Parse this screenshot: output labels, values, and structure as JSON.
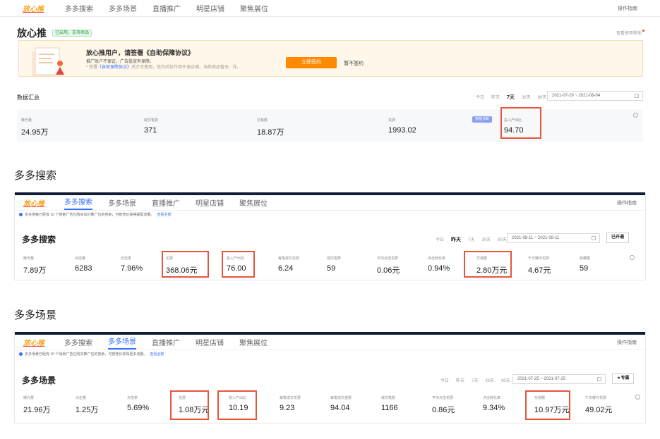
{
  "nav_items": [
    "多多搜索",
    "多多场景",
    "直播推广",
    "明星店铺",
    "聚焦展位"
  ],
  "logo_text": "放心推",
  "nav_right": "操作指南",
  "s1": {
    "title": "放心推",
    "badge": "已启用，支持商品",
    "help": "查看使用帮助",
    "banner": {
      "title": "放心推用户，请签署《自助保障协议》",
      "line1": "推广账户不保证，广告投放有保障。",
      "line2_pre": "* 签署",
      "line2_link": "《自助保障协议》",
      "line2_post": "后才可使用，签约后仅作用于该店铺，当前商品暂无 · 详。",
      "button": "立即签约",
      "after": "暂不签约"
    },
    "summary_title": "数据汇总",
    "quick_dates": [
      "今日",
      "昨天",
      "7天",
      "30天",
      "90天"
    ],
    "active_quick": "7天",
    "date_range": "2021-07-29 ~ 2021-08-04",
    "smart_button": "智能诊断",
    "metrics": [
      {
        "label": "曝光量",
        "value": "24.95万"
      },
      {
        "label": "成交笔数",
        "value": "371"
      },
      {
        "label": "交易额",
        "value": "18.87万"
      },
      {
        "label": "花费",
        "value": "1993.02"
      },
      {
        "label": "投入产出比",
        "value": "94.70"
      }
    ]
  },
  "caption2": "多多搜索",
  "s2": {
    "notice": "多多搜索已经有 10 个搜索广告位购买出价推广位的竞争，可按竞价获得提取流量。",
    "notice_link": "查看全部",
    "title": "多多搜索",
    "quick_dates": [
      "今日",
      "昨天",
      "7天",
      "30天",
      "90天"
    ],
    "active_quick": "昨天",
    "date_range": "2021-08-11 ~ 2021-08-11",
    "button": "已开通",
    "metrics": [
      {
        "label": "曝光量",
        "value": "7.89万"
      },
      {
        "label": "点击量",
        "value": "6283"
      },
      {
        "label": "点击率",
        "value": "7.96%"
      },
      {
        "label": "花费",
        "value": "368.06元"
      },
      {
        "label": "投入产出比",
        "value": "76.00"
      },
      {
        "label": "每笔成交花费",
        "value": "6.24"
      },
      {
        "label": "成交笔数",
        "value": "59"
      },
      {
        "label": "平均点击花费",
        "value": "0.06元"
      },
      {
        "label": "点击转化率",
        "value": "0.94%"
      },
      {
        "label": "交易额",
        "value": "2.80万元"
      },
      {
        "label": "千次曝光花费",
        "value": "4.67元"
      },
      {
        "label": "收藏量",
        "value": "59"
      }
    ]
  },
  "caption3": "多多场景",
  "s3": {
    "notice": "多多场景已经有 10 个场景广告位购买推广位的竞争，可按竞价获得更多流量。",
    "notice_link": "查看全部",
    "title": "多多场景",
    "quick_dates": [
      "今日",
      "昨天",
      "7天",
      "30天",
      "90天"
    ],
    "active_quick": "",
    "date_range": "2021-07-25 ~ 2021-07-25",
    "button": "★专属",
    "metrics": [
      {
        "label": "曝光量",
        "value": "21.96万"
      },
      {
        "label": "点击量",
        "value": "1.25万"
      },
      {
        "label": "点击率",
        "value": "5.69%"
      },
      {
        "label": "花费",
        "value": "1.08万元"
      },
      {
        "label": "投入产出比",
        "value": "10.19"
      },
      {
        "label": "每笔成交花费",
        "value": "9.23"
      },
      {
        "label": "每笔成交金额",
        "value": "94.04"
      },
      {
        "label": "成交笔数",
        "value": "1166"
      },
      {
        "label": "平均点击花费",
        "value": "0.86元"
      },
      {
        "label": "点击转化率",
        "value": "9.34%"
      },
      {
        "label": "交易额",
        "value": "10.97万元"
      },
      {
        "label": "千次曝光花费",
        "value": "49.02元"
      }
    ]
  },
  "colors": {
    "highlight": "#e8543c",
    "accent": "#3370ff",
    "banner_button": "#ff8a00",
    "header_bar": "#111b33"
  }
}
